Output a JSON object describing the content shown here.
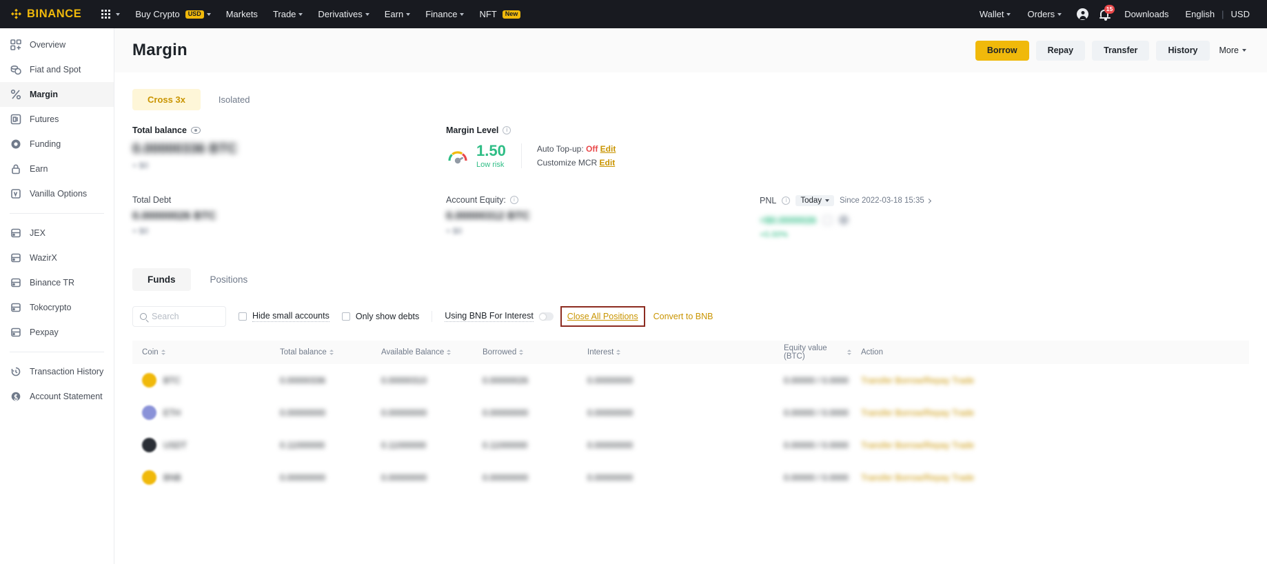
{
  "topnav": {
    "brand": "BINANCE",
    "apps_icon": "grid-icon",
    "items": [
      {
        "label": "Buy Crypto",
        "badge": "USD",
        "caret": true
      },
      {
        "label": "Markets",
        "caret": false
      },
      {
        "label": "Trade",
        "caret": true
      },
      {
        "label": "Derivatives",
        "caret": true
      },
      {
        "label": "Earn",
        "caret": true
      },
      {
        "label": "Finance",
        "caret": true
      },
      {
        "label": "NFT",
        "badge": "New",
        "caret": false
      }
    ],
    "right": {
      "wallet": "Wallet",
      "orders": "Orders",
      "notification_count": "15",
      "downloads": "Downloads",
      "language": "English",
      "separator": "|",
      "currency": "USD"
    }
  },
  "sidebar": {
    "items": [
      {
        "label": "Overview",
        "icon": "dashboard-icon",
        "active": false
      },
      {
        "label": "Fiat and Spot",
        "icon": "coins-icon",
        "active": false
      },
      {
        "label": "Margin",
        "icon": "percent-icon",
        "active": true
      },
      {
        "label": "Futures",
        "icon": "futures-icon",
        "active": false
      },
      {
        "label": "Funding",
        "icon": "funding-icon",
        "active": false
      },
      {
        "label": "Earn",
        "icon": "lock-icon",
        "active": false
      },
      {
        "label": "Vanilla Options",
        "icon": "options-icon",
        "active": false
      }
    ],
    "partners": [
      {
        "label": "JEX",
        "icon": "exchange-icon"
      },
      {
        "label": "WazirX",
        "icon": "exchange-icon"
      },
      {
        "label": "Binance TR",
        "icon": "exchange-icon"
      },
      {
        "label": "Tokocrypto",
        "icon": "exchange-icon"
      },
      {
        "label": "Pexpay",
        "icon": "exchange-icon"
      }
    ],
    "footer": [
      {
        "label": "Transaction History",
        "icon": "history-icon"
      },
      {
        "label": "Account Statement",
        "icon": "statement-icon"
      }
    ]
  },
  "header": {
    "title": "Margin",
    "buttons": [
      {
        "label": "Borrow",
        "style": "primary"
      },
      {
        "label": "Repay",
        "style": "default"
      },
      {
        "label": "Transfer",
        "style": "default"
      },
      {
        "label": "History",
        "style": "default"
      },
      {
        "label": "More",
        "style": "link"
      }
    ]
  },
  "mode_tabs": [
    {
      "label": "Cross 3x",
      "active": true
    },
    {
      "label": "Isolated",
      "active": false
    }
  ],
  "summary": {
    "total_balance": {
      "label": "Total balance",
      "icon": "eye-icon",
      "value": "0.00000336 BTC",
      "sub": "≈ $0"
    },
    "margin_level": {
      "label": "Margin Level",
      "info_icon": "info-icon",
      "gauge_icon": "gauge-icon",
      "value": "1.50",
      "risk": "Low risk",
      "auto_topup_label": "Auto Top-up:",
      "auto_topup_value": "Off",
      "auto_topup_edit": "Edit",
      "customize_mcr_label": "Customize MCR",
      "customize_mcr_edit": "Edit"
    },
    "pnl": {
      "label": "PNL",
      "info_icon": "info-icon",
      "period": "Today",
      "since": "Since 2022-03-18 15:35",
      "value": "+$0.0000026",
      "percent": "+0.00%"
    },
    "total_debt": {
      "label": "Total Debt",
      "value": "0.00000026 BTC",
      "sub": "≈ $0"
    },
    "account_equity": {
      "label": "Account Equity:",
      "info_icon": "info-icon",
      "value": "0.00000312 BTC",
      "sub": "≈ $0"
    }
  },
  "funds_tabs": [
    {
      "label": "Funds",
      "active": true
    },
    {
      "label": "Positions",
      "active": false
    }
  ],
  "filters": {
    "search_placeholder": "Search",
    "search_icon": "search-icon",
    "hide_small_accounts": "Hide small accounts",
    "only_show_debts": "Only show debts",
    "using_bnb_for_interest": "Using BNB For Interest",
    "close_all_positions": "Close All Positions",
    "convert_to_bnb": "Convert to BNB"
  },
  "table": {
    "columns": [
      {
        "label": "Coin",
        "sortable": true
      },
      {
        "label": "Total balance",
        "sortable": true
      },
      {
        "label": "Available Balance",
        "sortable": true
      },
      {
        "label": "Borrowed",
        "sortable": true
      },
      {
        "label": "Interest",
        "sortable": true
      },
      {
        "label": "Equity value (BTC)",
        "sortable": true
      },
      {
        "label": "Action",
        "sortable": false
      }
    ],
    "rows": [
      {
        "coin": "BTC",
        "color": "#f0b90b",
        "total": "0.00000336",
        "available": "0.00000310",
        "borrowed": "0.00000026",
        "interest": "0.00000000",
        "equity": "0.00000 / 0.0000",
        "actions": "Transfer  Borrow/Repay  Trade"
      },
      {
        "coin": "ETH",
        "color": "#8a92d8",
        "total": "0.00000000",
        "available": "0.00000000",
        "borrowed": "0.00000000",
        "interest": "0.00000000",
        "equity": "0.00000 / 0.0000",
        "actions": "Transfer  Borrow/Repay  Trade"
      },
      {
        "coin": "USDT",
        "color": "#2b2f36",
        "total": "0.11000000",
        "available": "0.11000000",
        "borrowed": "0.11000000",
        "interest": "0.00000000",
        "equity": "0.00000 / 0.0000",
        "actions": "Transfer  Borrow/Repay  Trade"
      },
      {
        "coin": "BNB",
        "color": "#f0b90b",
        "total": "0.00000000",
        "available": "0.00000000",
        "borrowed": "0.00000000",
        "interest": "0.00000000",
        "equity": "0.00000 / 0.0000",
        "actions": "Transfer  Borrow/Repay  Trade"
      }
    ]
  },
  "colors": {
    "brand_yellow": "#f0b90b",
    "nav_dark": "#181a20",
    "green": "#2ebd85",
    "red": "#e9484a",
    "annotation_red": "#8c2b20",
    "gold_link": "#c99400"
  }
}
